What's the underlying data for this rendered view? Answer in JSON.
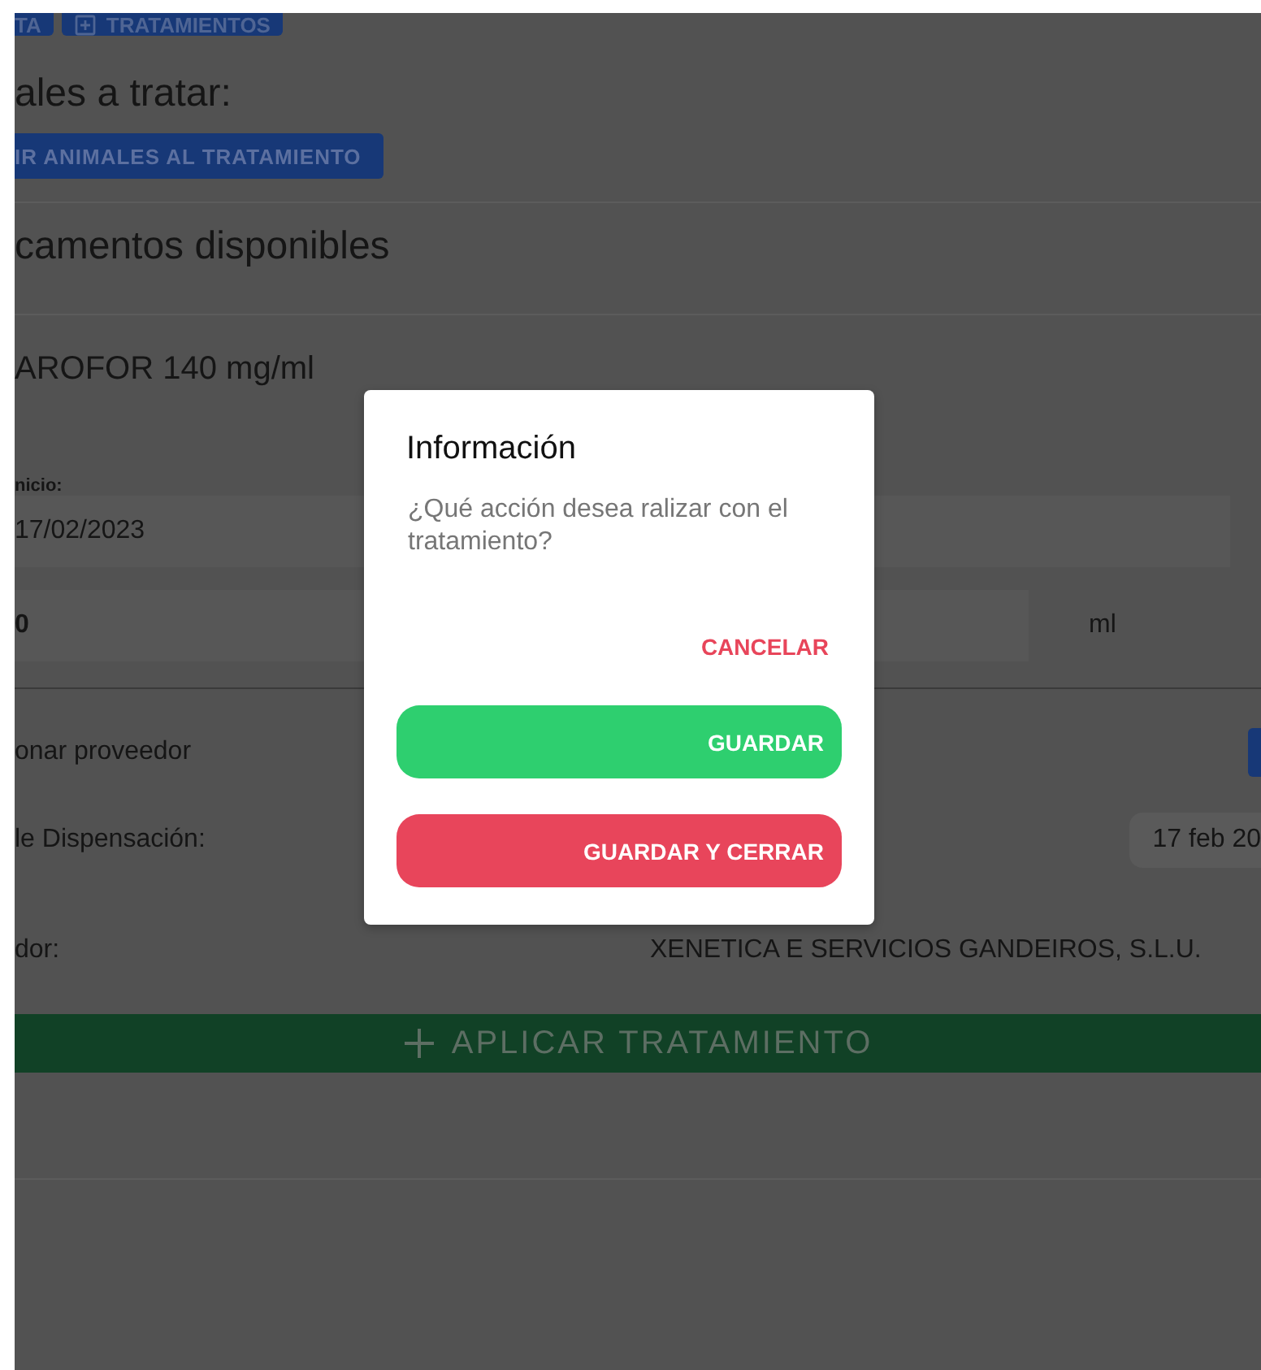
{
  "toolbar": [
    {
      "label": "TA",
      "kind": "text"
    },
    {
      "label": "TRATAMIENTOS",
      "kind": "add"
    }
  ],
  "animals": {
    "heading": "ales a tratar:",
    "button": "IR ANIMALES AL TRATAMIENTO"
  },
  "medicines": {
    "heading": "camentos disponibles",
    "name": "AROFOR 140 mg/ml"
  },
  "start": {
    "label": "nicio:",
    "value": "17/02/2023"
  },
  "dose": {
    "value": "0",
    "unit": "ml"
  },
  "details": [
    {
      "label": "onar proveedor",
      "kind": "button"
    },
    {
      "label": "le Dispensación:",
      "kind": "date",
      "value": "17 feb 20"
    },
    {
      "label": "dor:",
      "kind": "text",
      "value": "XENETICA E SERVICIOS GANDEIROS, S.L.U."
    }
  ],
  "apply_button": "APLICAR TRATAMIENTO",
  "dialog": {
    "title": "Información",
    "message": "¿Qué acción desea ralizar con el tratamiento?",
    "actions": [
      {
        "label": "CANCELAR",
        "kind": "text"
      },
      {
        "label": "GUARDAR",
        "kind": "save"
      },
      {
        "label": "GUARDAR Y CERRAR",
        "kind": "save_close"
      }
    ]
  }
}
